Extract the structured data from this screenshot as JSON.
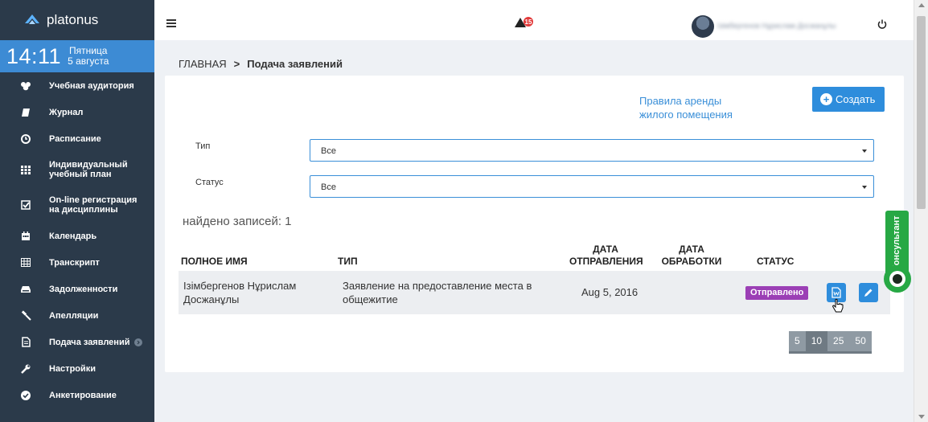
{
  "app": {
    "name": "platonus"
  },
  "clock": {
    "time": "14:11",
    "weekday": "Пятница",
    "date": "5 августа"
  },
  "sidebar": {
    "items": [
      {
        "label": "Учебная аудитория",
        "icon": "group-icon"
      },
      {
        "label": "Журнал",
        "icon": "book-icon"
      },
      {
        "label": "Расписание",
        "icon": "clock-icon"
      },
      {
        "label": "Индивидуальный учебный план",
        "icon": "grid-icon"
      },
      {
        "label": "On-line регистрация на дисциплины",
        "icon": "checkbox-icon"
      },
      {
        "label": "Календарь",
        "icon": "calendar-icon"
      },
      {
        "label": "Транскрипт",
        "icon": "table-icon"
      },
      {
        "label": "Задолженности",
        "icon": "hdd-icon"
      },
      {
        "label": "Апелляции",
        "icon": "gavel-icon"
      },
      {
        "label": "Подача заявлений",
        "icon": "file-icon"
      },
      {
        "label": "Настройки",
        "icon": "wrench-icon"
      },
      {
        "label": "Анкетирование",
        "icon": "check-circle-icon"
      }
    ]
  },
  "header": {
    "notifications_count": "15",
    "user_name": "Ізімбергенов Нұрислам Досжанұлы"
  },
  "breadcrumb": {
    "home": "ГЛАВНАЯ",
    "separator": ">",
    "current": "Подача заявлений"
  },
  "panel": {
    "rules_link": "Правила аренды жилого помещения",
    "create_label": "Создать",
    "filters": {
      "type_label": "Тип",
      "type_value": "Все",
      "status_label": "Статус",
      "status_value": "Все"
    },
    "found_text": "найдено записей: 1",
    "table": {
      "headers": {
        "full_name": "ПОЛНОЕ ИМЯ",
        "type": "ТИП",
        "sent_date": "ДАТА ОТПРАВЛЕНИЯ",
        "processed_date": "ДАТА ОБРАБОТКИ",
        "status": "СТАТУС"
      },
      "rows": [
        {
          "full_name": "Ізімбергенов Нұрислам Досжанұлы",
          "type": "Заявление на предоставление места в общежитие",
          "sent_date": "Aug 5, 2016",
          "processed_date": "",
          "status": "Отправлено"
        }
      ]
    },
    "pager": [
      "5",
      "10",
      "25",
      "50"
    ],
    "pager_active": "10"
  },
  "consultant": {
    "label": "Консультант"
  },
  "colors": {
    "sidebar_bg": "#2b3a4a",
    "accent_blue": "#2e8ddc",
    "status_purple": "#9b3fb5",
    "consultant_green": "#27a844"
  }
}
